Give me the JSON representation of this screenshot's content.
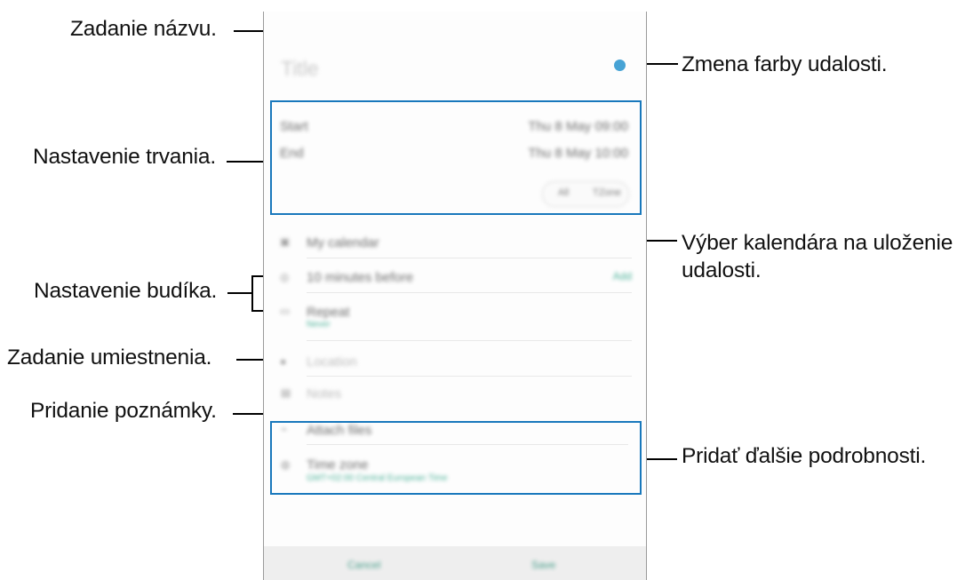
{
  "callouts": {
    "title": "Zadanie názvu.",
    "color": "Zmena farby udalosti.",
    "duration": "Nastavenie trvania.",
    "calendar_line1": "Výber kalendára na uloženie",
    "calendar_line2": "udalosti.",
    "alarm": "Nastavenie budíka.",
    "location": "Zadanie umiestnenia.",
    "note": "Pridanie poznámky.",
    "details": "Pridať ďalšie podrobnosti."
  },
  "screen": {
    "title": "Title",
    "start_label": "Start",
    "start_value": "Thu 8 May 09:00",
    "end_label": "End",
    "end_value": "Thu 8 May 10:00",
    "all_day": "All",
    "time_zone_toggle": "TZone",
    "calendar": "My calendar",
    "reminder": "10 minutes before",
    "reminder_action": "Add",
    "repeat": "Repeat",
    "repeat_value": "Never",
    "location": "Location",
    "notes": "Notes",
    "attachments": "Attach files",
    "timezone_title": "Time zone",
    "timezone_value": "GMT+02:00 Central European Time",
    "cancel": "Cancel",
    "save": "Save"
  },
  "colors": {
    "highlight": "#1978bc",
    "event_color": "#47a3d5",
    "accent": "#1a9d7d"
  }
}
